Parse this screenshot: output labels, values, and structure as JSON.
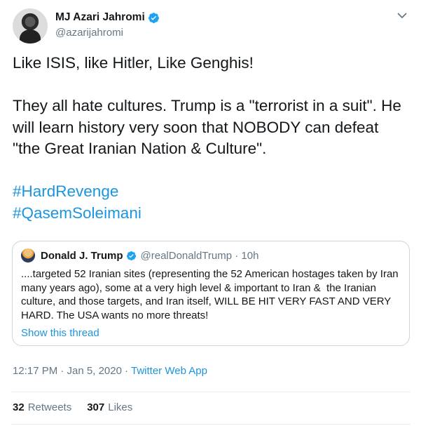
{
  "author": {
    "name": "MJ Azari Jahromi",
    "handle": "@azarijahromi"
  },
  "tweet": {
    "line1": "Like ISIS, like Hitler, Like Genghis!",
    "line2": "They all hate cultures. Trump is a \"terrorist in a suit\". He",
    "line3": "will learn history very soon that NOBODY can defeat",
    "line4": "\"the Great Iranian Nation & Culture\".",
    "hashtag1": "#HardRevenge",
    "hashtag2": "#QasemSoleimani"
  },
  "quote": {
    "name": "Donald J. Trump",
    "meta": "@realDonaldTrump · 10h",
    "line1": "....targeted 52 Iranian sites (representing the 52 American hostages taken by Iran",
    "line2": "many years ago), some at a very high level & important to Iran &  the Iranian",
    "line3": "culture, and those targets, and Iran itself, WILL BE HIT VERY FAST AND VERY",
    "line4": "HARD. The USA wants no more threats!",
    "show_thread": "Show this thread"
  },
  "meta": {
    "time_date": "12:17 PM · Jan 5, 2020 · ",
    "app": "Twitter Web App"
  },
  "stats": {
    "retweets_count": "32",
    "retweets_label": "Retweets",
    "likes_count": "307",
    "likes_label": "Likes"
  },
  "icons": {
    "verified": "verified-badge-icon",
    "caret": "chevron-down-icon"
  },
  "colors": {
    "link": "#1b95e0",
    "secondary_text": "#657786",
    "border": "#ccd6dd"
  }
}
